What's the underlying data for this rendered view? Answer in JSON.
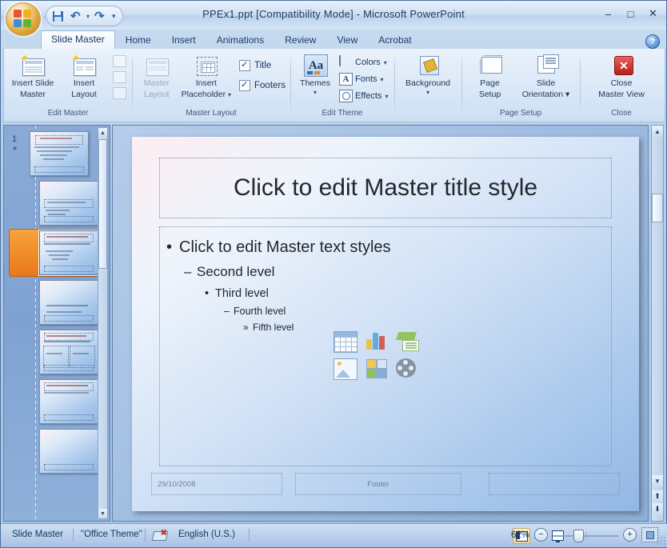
{
  "window": {
    "title": "PPEx1.ppt [Compatibility Mode] - Microsoft PowerPoint",
    "minimize": "–",
    "maximize": "□",
    "close": "✕",
    "help": "?"
  },
  "quick_access": {
    "save": "save-icon",
    "undo": "↶",
    "undo_caret": "▾",
    "redo": "↷",
    "customize_caret": "▾"
  },
  "tabs": [
    {
      "label": "Slide Master",
      "active": true
    },
    {
      "label": "Home",
      "active": false
    },
    {
      "label": "Insert",
      "active": false
    },
    {
      "label": "Animations",
      "active": false
    },
    {
      "label": "Review",
      "active": false
    },
    {
      "label": "View",
      "active": false
    },
    {
      "label": "Acrobat",
      "active": false
    }
  ],
  "ribbon": {
    "groups": [
      {
        "name": "Edit Master",
        "label": "Edit Master",
        "buttons": [
          {
            "label_line1": "Insert Slide",
            "label_line2": "Master",
            "disabled": false
          },
          {
            "label_line1": "Insert",
            "label_line2": "Layout",
            "disabled": false
          }
        ]
      },
      {
        "name": "Master Layout",
        "label": "Master Layout",
        "buttons": [
          {
            "label_line1": "Master",
            "label_line2": "Layout",
            "disabled": true
          },
          {
            "label_line1": "Insert",
            "label_line2": "Placeholder",
            "disabled": false,
            "caret": "▾"
          }
        ],
        "checkboxes": [
          {
            "label": "Title",
            "checked": true
          },
          {
            "label": "Footers",
            "checked": true
          }
        ]
      },
      {
        "name": "Edit Theme",
        "label": "Edit Theme",
        "buttons": [
          {
            "label_line1": "Themes",
            "label_line2": "▾",
            "disabled": false
          }
        ],
        "small_buttons": [
          {
            "label": "Colors",
            "caret": "▾"
          },
          {
            "label": "Fonts",
            "caret": "▾"
          },
          {
            "label": "Effects",
            "caret": "▾"
          }
        ]
      },
      {
        "name": "Background",
        "label": "",
        "buttons": [
          {
            "label_line1": "Background",
            "label_line2": "▾",
            "disabled": false
          }
        ]
      },
      {
        "name": "Page Setup",
        "label": "Page Setup",
        "buttons": [
          {
            "label_line1": "Page",
            "label_line2": "Setup",
            "disabled": false
          },
          {
            "label_line1": "Slide",
            "label_line2": "Orientation ▾",
            "disabled": false
          }
        ]
      },
      {
        "name": "Close",
        "label": "Close",
        "buttons": [
          {
            "label_line1": "Close",
            "label_line2": "Master View",
            "disabled": false
          }
        ]
      }
    ]
  },
  "slide_pane": {
    "slides": [
      {
        "number": "1",
        "selected": false,
        "layout": "title-and-content"
      },
      {
        "number": "",
        "selected": false,
        "layout": "title-only-lower"
      },
      {
        "number": "",
        "selected": true,
        "layout": "title-and-text"
      },
      {
        "number": "",
        "selected": false,
        "layout": "section-header"
      },
      {
        "number": "",
        "selected": false,
        "layout": "two-content"
      },
      {
        "number": "",
        "selected": false,
        "layout": "title-only"
      },
      {
        "number": "",
        "selected": false,
        "layout": "blank"
      }
    ],
    "scroll_up": "▲",
    "scroll_down": "▼"
  },
  "slide": {
    "title_placeholder": "Click to edit Master title style",
    "levels": [
      {
        "bullet": "•",
        "text": "Click to edit Master text styles"
      },
      {
        "bullet": "–",
        "text": "Second level"
      },
      {
        "bullet": "•",
        "text": "Third level"
      },
      {
        "bullet": "–",
        "text": "Fourth level"
      },
      {
        "bullet": "»",
        "text": "Fifth level"
      }
    ],
    "insert_icons": [
      "table-icon",
      "chart-icon",
      "smartart-icon",
      "picture-icon",
      "clipart-icon",
      "media-clip-icon"
    ],
    "footer": {
      "date": "29/10/2008",
      "center": "Footer",
      "right": ""
    }
  },
  "scrollbar": {
    "up": "▲",
    "down": "▼",
    "prev_slide": "⬆",
    "next_slide": "⬇"
  },
  "status_bar": {
    "view_name": "Slide Master",
    "theme_name": "\"Office Theme\"",
    "language": "English (U.S.)",
    "spell_icon": "spell-check-icon",
    "views": [
      "normal-view-icon",
      "slide-sorter-icon",
      "slide-show-icon"
    ],
    "zoom_level": "62%",
    "zoom_out": "−",
    "zoom_in": "+",
    "fit_to_window": "fit-slide-to-window-icon"
  },
  "colors": {
    "accent": "#2f6fb5",
    "selection": "#e8781b",
    "ribbon_bg": "#dbe8f7",
    "workspace": "#9dbbe0"
  }
}
